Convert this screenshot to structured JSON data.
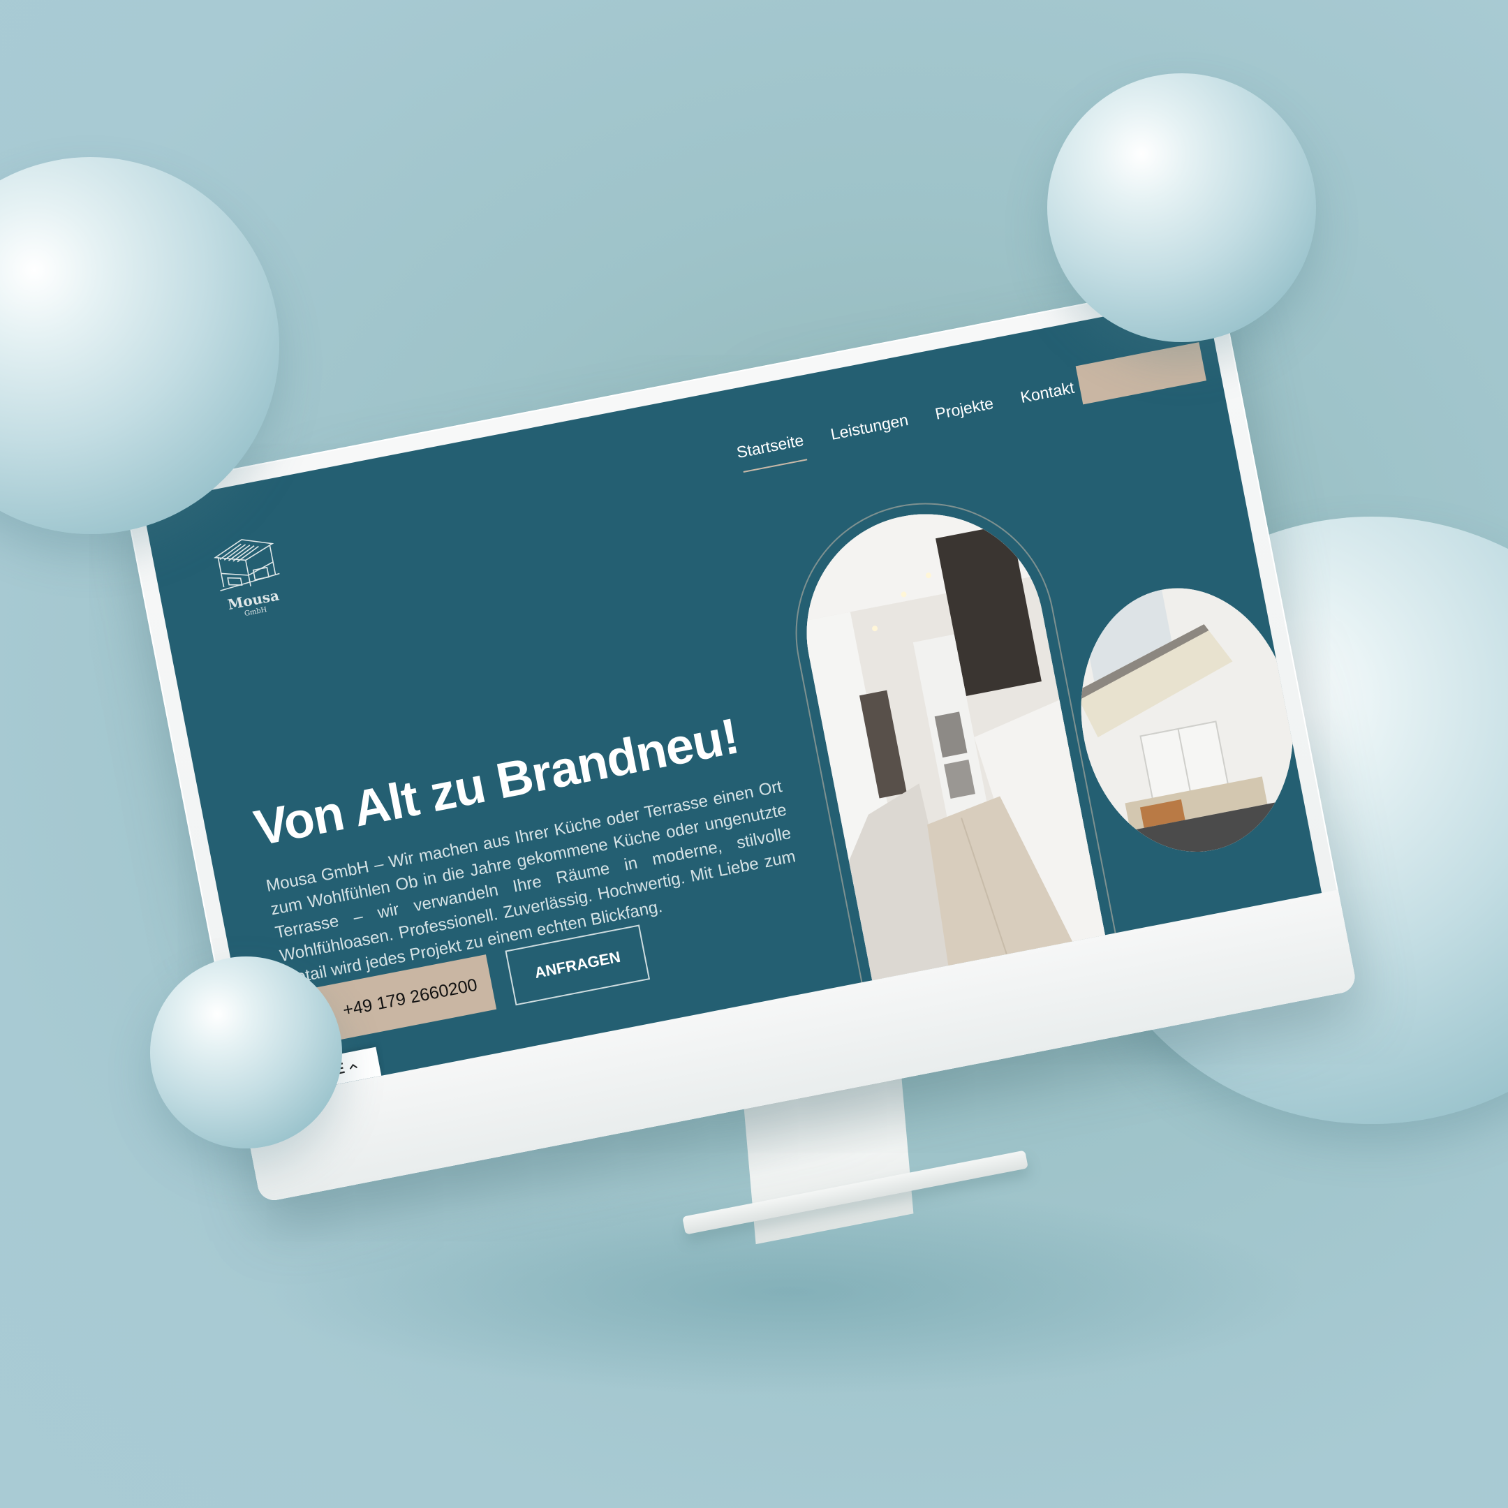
{
  "site": {
    "logo": {
      "name": "Mousa",
      "sub": "GmbH"
    },
    "nav": [
      {
        "label": "Startseite",
        "active": true
      },
      {
        "label": "Leistungen",
        "active": false
      },
      {
        "label": "Projekte",
        "active": false
      },
      {
        "label": "Kontakt",
        "active": false
      }
    ],
    "hero": {
      "title": "Von Alt zu Brandneu!",
      "description": "Mousa GmbH – Wir machen aus Ihrer Küche oder Terrasse einen Ort zum Wohlfühlen Ob in die Jahre gekommene Küche oder ungenutzte Terrasse – wir verwandeln Ihre Räume in moderne, stilvolle Wohlfühloasen. Professionell. Zuverlässig. Hochwertig. Mit Liebe zum Detail wird jedes Projekt zu einem echten Blickfang.",
      "phone_button": "+49 179 2660200",
      "cta_button": "ANFRAGEN"
    },
    "language": {
      "current": "DE",
      "icon": "chevron-up-icon"
    }
  },
  "colors": {
    "background": "#a7cad2",
    "brand": "#245f72",
    "accent": "#c9b6a3"
  }
}
